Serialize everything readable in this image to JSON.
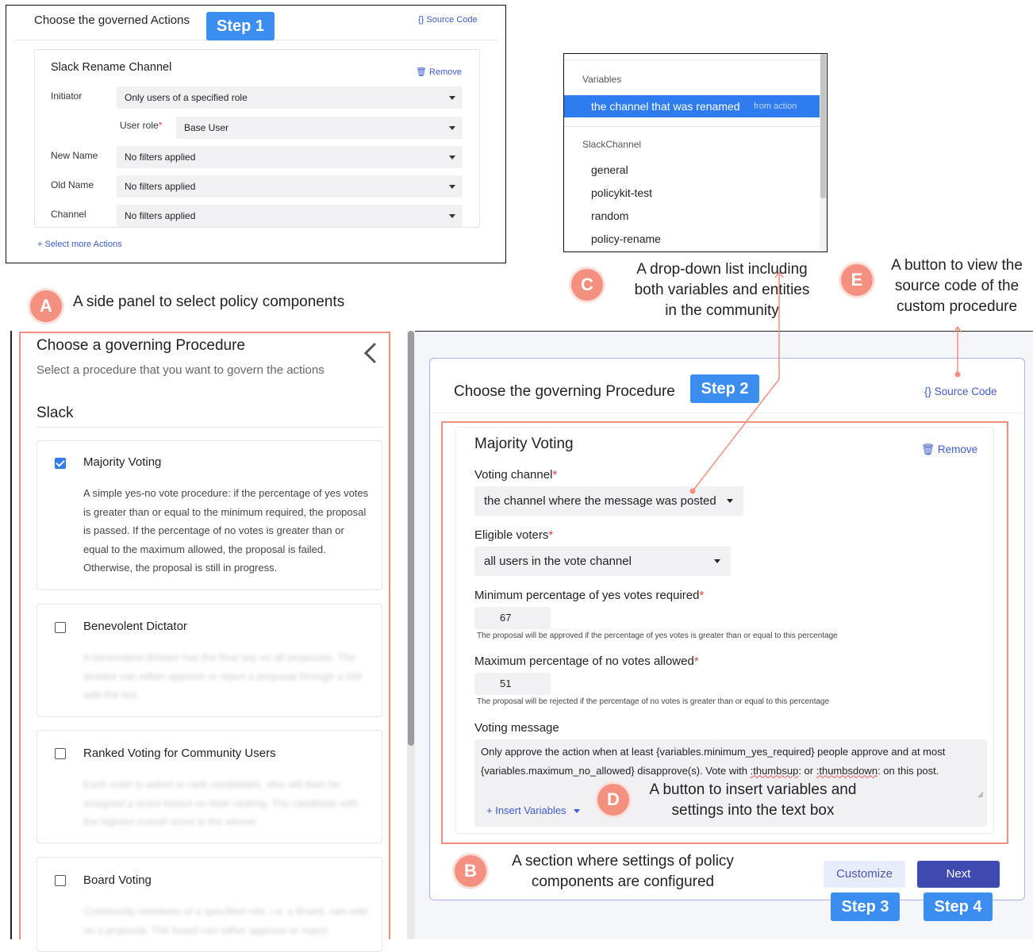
{
  "actions_panel": {
    "title": "Choose the governed Actions",
    "step": "Step 1",
    "source_code": "{} Source Code",
    "action_card": {
      "title": "Slack Rename Channel",
      "remove": "Remove",
      "rows": [
        {
          "label": "Initiator",
          "value": "Only users of a specified role"
        },
        {
          "label": "User role",
          "value": "Base User"
        },
        {
          "label": "New Name",
          "value": "No filters applied"
        },
        {
          "label": "Old Name",
          "value": "No filters applied"
        },
        {
          "label": "Channel",
          "value": "No filters applied"
        }
      ]
    },
    "select_more": "+ Select more Actions"
  },
  "dropdown": {
    "group_variables": "Variables",
    "selected_item": "the channel that was renamed",
    "selected_source": "from action",
    "group_channels": "SlackChannel",
    "channels": [
      "general",
      "policykit-test",
      "random",
      "policy-rename"
    ]
  },
  "callouts": {
    "a": {
      "letter": "A",
      "text": "A side panel to select policy components"
    },
    "b": {
      "letter": "B",
      "line1": "A section where settings of policy",
      "line2": "components are configured"
    },
    "c": {
      "letter": "C",
      "line1": "A drop-down list including",
      "line2": "both variables and entities",
      "line3": "in the community"
    },
    "d": {
      "letter": "D",
      "line1": "A button to insert variables and",
      "line2": "settings into the text box"
    },
    "e": {
      "letter": "E",
      "line1": "A button to view the",
      "line2": "source code of the",
      "line3": "custom procedure"
    }
  },
  "side_panel": {
    "title": "Choose a governing Procedure",
    "subtitle": "Select a procedure that you want to govern the actions",
    "section": "Slack",
    "procedures": [
      {
        "name": "Majority Voting",
        "checked": true,
        "description": "A simple yes-no vote procedure: if the percentage of yes votes is greater than or equal to the minimum required, the proposal is passed. If the percentage of no votes is greater than or equal to the maximum allowed, the proposal is failed. Otherwise, the proposal is still in progress."
      },
      {
        "name": "Benevolent Dictator",
        "checked": false,
        "description": "A benevolent dictator has the final say on all proposals. The dictator can either approve or reject a proposal through a DM with the bot."
      },
      {
        "name": "Ranked Voting for Community Users",
        "checked": false,
        "description": "Each voter is asked to rank candidates, who will then be assigned a score based on their ranking. The candidate with the highest overall score is the winner."
      },
      {
        "name": "Board Voting",
        "checked": false,
        "description": "Community members of a specified role, i.e. a Board, can vote on a proposal. The board can either approve or reject."
      }
    ]
  },
  "main_panel": {
    "title": "Choose the governing Procedure",
    "step": "Step 2",
    "source_code": "{} Source Code",
    "procedure": {
      "title": "Majority Voting",
      "remove": "Remove",
      "voting_channel_label": "Voting channel",
      "voting_channel_value": "the channel where the message was posted",
      "eligible_label": "Eligible voters",
      "eligible_value": "all users in the vote channel",
      "min_label": "Minimum percentage of yes votes required",
      "min_value": "67",
      "min_help": "The proposal will be approved if the percentage of yes votes is greater than or equal to this percentage",
      "max_label": "Maximum percentage of no votes allowed",
      "max_value": "51",
      "max_help": "The proposal will be rejected if the percentage of no votes is greater than or equal to this percentage",
      "message_label": "Voting message",
      "message_part1": "Only approve the action when at least  {variables.minimum_yes_required} people approve and at most {variables.maximum_no_allowed} disapprove(s). Vote with ",
      "message_thumbsup": ":thumbsup",
      "message_part2": ": or ",
      "message_thumbsdown": ":thumbsdown",
      "message_part3": ": on this post.",
      "insert_variables": "+ Insert Variables"
    },
    "customize": "Customize",
    "next": "Next",
    "step3": "Step 3",
    "step4": "Step 4"
  },
  "colors": {
    "accent_blue": "#3b8def",
    "callout": "#f4907f",
    "next_button": "#3f4ab0",
    "customize_bg": "#e9edfb"
  }
}
